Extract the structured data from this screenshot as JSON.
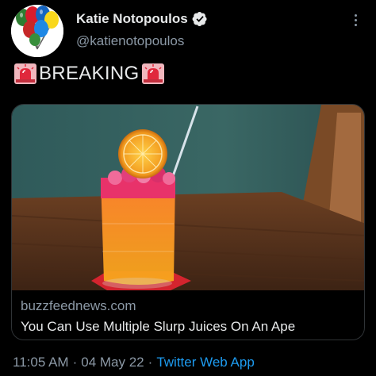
{
  "tweet": {
    "author": {
      "display_name": "Katie Notopoulos",
      "handle": "@katienotopoulos",
      "verified": true,
      "avatar_icon": "balloons-avatar"
    },
    "more_icon": "more-options-icon",
    "text": {
      "leading_emoji": "rotating-light-icon",
      "word": "BREAKING",
      "trailing_emoji": "rotating-light-icon"
    },
    "link_card": {
      "image_description": "orange and red cocktail with orange slice and straw",
      "domain": "buzzfeednews.com",
      "title": "You Can Use Multiple Slurp Juices On An Ape"
    },
    "footer": {
      "time": "11:05 AM",
      "separator": "·",
      "date": "04 May 22",
      "source": "Twitter Web App"
    }
  },
  "colors": {
    "background": "#000000",
    "text_primary": "#e7e9ea",
    "text_secondary": "#8b98a5",
    "link": "#1d9bf0",
    "border": "#2f3336"
  }
}
